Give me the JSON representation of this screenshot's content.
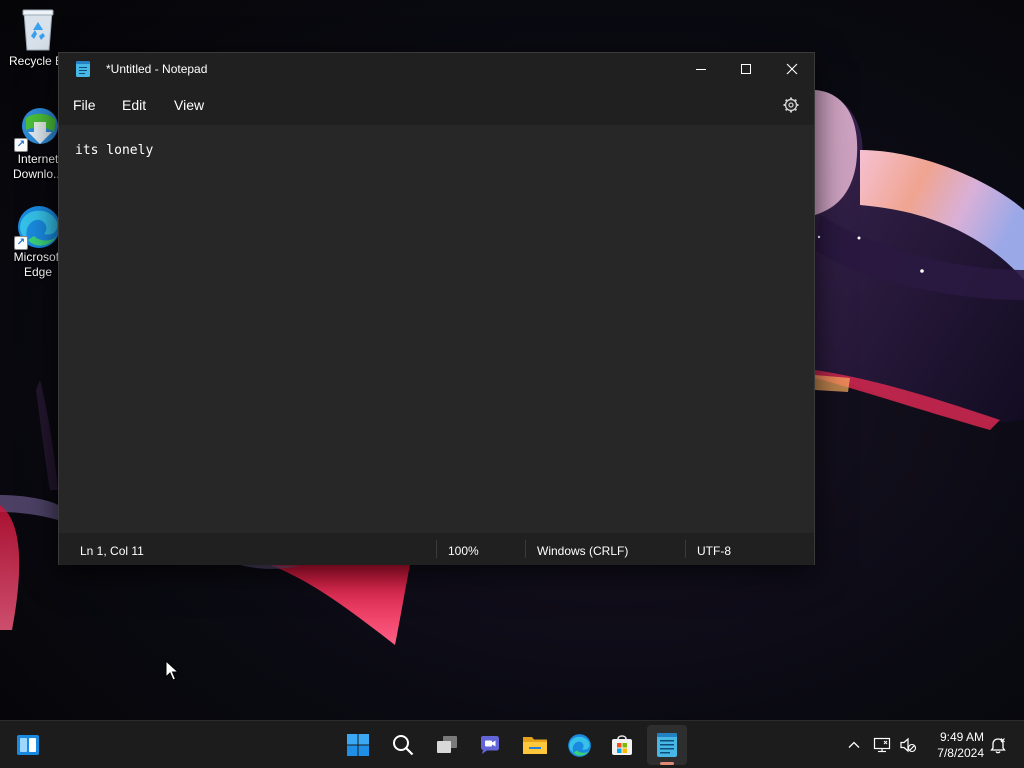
{
  "desktop": {
    "icons": [
      {
        "label": "Recycle Bin",
        "icon": "recycle-bin-icon"
      },
      {
        "label": "Internet Downlo...",
        "icon": "internet-download-manager-icon"
      },
      {
        "label": "Microsoft Edge",
        "icon": "edge-icon"
      }
    ]
  },
  "window": {
    "title": "*Untitled - Notepad",
    "app_icon": "notepad-icon",
    "controls": {
      "minimize": "minimize-icon",
      "maximize": "maximize-icon",
      "close": "close-icon"
    }
  },
  "menu": {
    "items": [
      {
        "label": "File"
      },
      {
        "label": "Edit"
      },
      {
        "label": "View"
      }
    ],
    "settings_icon": "gear-icon"
  },
  "editor": {
    "content": "its lonely"
  },
  "status_bar": {
    "position": "Ln 1, Col 11",
    "zoom": "100%",
    "line_ending": "Windows (CRLF)",
    "encoding": "UTF-8"
  },
  "taskbar": {
    "apps": [
      {
        "name": "widgets",
        "icon": "widgets-icon"
      },
      {
        "name": "start",
        "icon": "windows-start-icon"
      },
      {
        "name": "search",
        "icon": "search-icon"
      },
      {
        "name": "task view",
        "icon": "task-view-icon"
      },
      {
        "name": "teams chat",
        "icon": "teams-chat-icon"
      },
      {
        "name": "file explorer",
        "icon": "folder-icon"
      },
      {
        "name": "edge",
        "icon": "edge-icon"
      },
      {
        "name": "microsoft store",
        "icon": "store-icon"
      },
      {
        "name": "notepad",
        "icon": "notepad-icon",
        "active": true
      }
    ],
    "tray": {
      "icons": [
        "chevron-up-icon",
        "network-icon",
        "volume-muted-icon",
        "notification-icon"
      ],
      "time": "9:49 AM",
      "date": "7/8/2024"
    }
  },
  "colors": {
    "window_bg": "#202020",
    "editor_bg": "#272727",
    "taskbar_bg": "#1c1c1c",
    "active_indicator": "#e08a76",
    "accent_blue": "#3aa0f0"
  }
}
